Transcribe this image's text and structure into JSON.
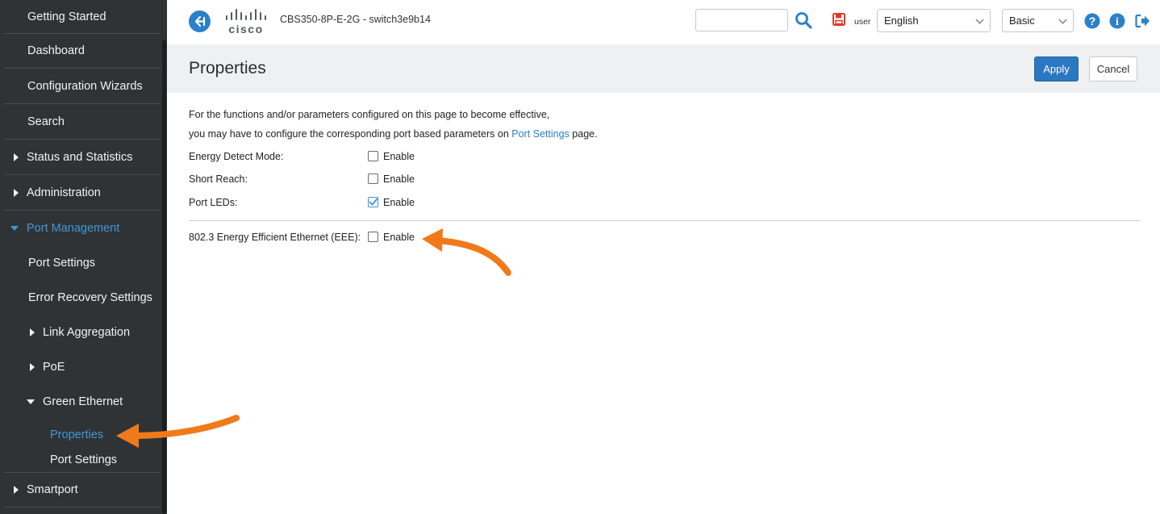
{
  "sidebar": {
    "items": [
      {
        "label": "Getting Started"
      },
      {
        "label": "Dashboard"
      },
      {
        "label": "Configuration Wizards"
      },
      {
        "label": "Search"
      },
      {
        "label": "Status and Statistics"
      },
      {
        "label": "Administration"
      },
      {
        "label": "Port Management"
      },
      {
        "label": "Port Settings"
      },
      {
        "label": "Error Recovery Settings"
      },
      {
        "label": "Link Aggregation"
      },
      {
        "label": "PoE"
      },
      {
        "label": "Green Ethernet"
      },
      {
        "label": "Properties"
      },
      {
        "label": "Port Settings"
      },
      {
        "label": "Smartport"
      }
    ]
  },
  "header": {
    "logo_text": "cisco",
    "device_title": "CBS350-8P-E-2G - switch3e9b14",
    "username": "user",
    "language": "English",
    "mode": "Basic"
  },
  "main": {
    "title": "Properties",
    "apply_label": "Apply",
    "cancel_label": "Cancel",
    "intro_line1": "For the functions and/or parameters configured on this page to become effective,",
    "intro_line2_pre": "you may have to configure the corresponding port based parameters on ",
    "intro_link": "Port Settings",
    "intro_line2_post": " page.",
    "fields": [
      {
        "label": "Energy Detect Mode:",
        "option": "Enable",
        "checked": false
      },
      {
        "label": "Short Reach:",
        "option": "Enable",
        "checked": false
      },
      {
        "label": "Port LEDs:",
        "option": "Enable",
        "checked": true
      },
      {
        "label": "802.3 Energy Efficient Ethernet (EEE):",
        "option": "Enable",
        "checked": false
      }
    ]
  },
  "colors": {
    "sidebar_bg": "#303335",
    "accent": "#2b80c9",
    "active_nav": "#3f98d8",
    "annotation_arrow": "#f07a1a"
  }
}
